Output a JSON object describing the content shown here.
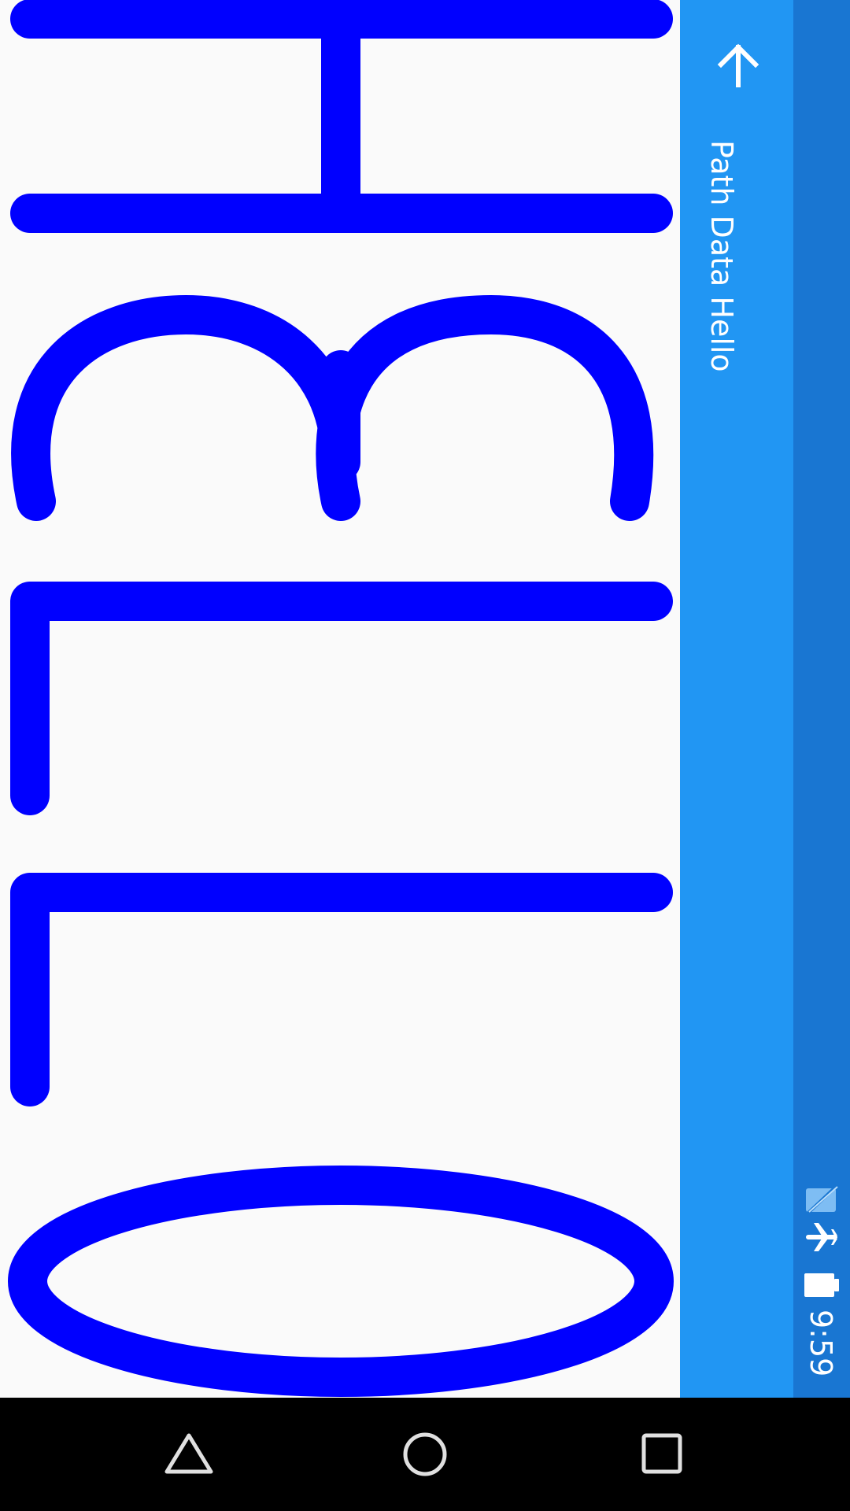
{
  "app": {
    "title": "Path Data Hello"
  },
  "canvas": {
    "text": "HELLO",
    "stroke_color": "#0000FF",
    "background_color": "#FAFAFA",
    "letters": [
      "H",
      "E",
      "L",
      "L",
      "O"
    ]
  },
  "toolbar": {
    "color": "#2196F3",
    "back_icon": "arrow-back-icon"
  },
  "status_bar": {
    "color": "#1976D2",
    "time": "9:59",
    "icons": [
      "no-sim-icon",
      "airplane-mode-icon",
      "battery-full-icon"
    ]
  },
  "nav_bar": {
    "buttons": [
      "back-triangle-icon",
      "home-circle-icon",
      "recents-square-icon"
    ]
  }
}
